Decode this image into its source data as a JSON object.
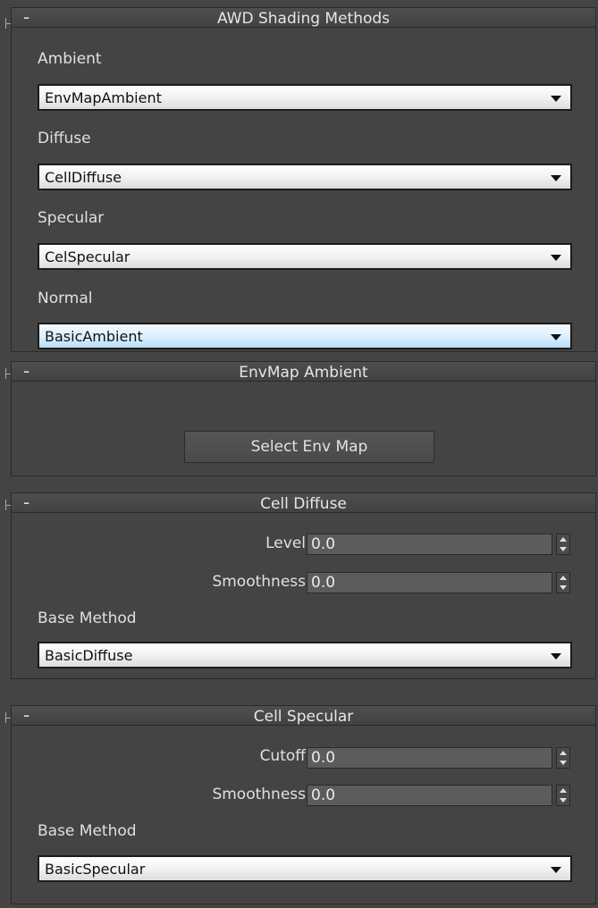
{
  "rollouts": {
    "awd_shading": {
      "collapse_symbol": "-",
      "title": "AWD Shading Methods",
      "ambient_label": "Ambient",
      "ambient_value": "EnvMapAmbient",
      "diffuse_label": "Diffuse",
      "diffuse_value": "CellDiffuse",
      "specular_label": "Specular",
      "specular_value": "CelSpecular",
      "normal_label": "Normal",
      "normal_value": "BasicAmbient"
    },
    "envmap_ambient": {
      "collapse_symbol": "-",
      "title": "EnvMap Ambient",
      "button_label": "Select Env Map"
    },
    "cell_diffuse": {
      "collapse_symbol": "-",
      "title": "Cell Diffuse",
      "level_label": "Level",
      "level_value": "0.0",
      "smoothness_label": "Smoothness",
      "smoothness_value": "0.0",
      "base_method_label": "Base Method",
      "base_method_value": "BasicDiffuse"
    },
    "cell_specular": {
      "collapse_symbol": "-",
      "title": "Cell Specular",
      "cutoff_label": "Cutoff",
      "cutoff_value": "0.0",
      "smoothness_label": "Smoothness",
      "smoothness_value": "0.0",
      "base_method_label": "Base Method",
      "base_method_value": "BasicSpecular"
    }
  },
  "colors": {
    "panel_bg": "#444444",
    "header_bg": "#4a4a4a",
    "dropdown_bg": "#f2f2f2",
    "dropdown_highlight": "#cfe8fb",
    "spinner_bg": "#5c5c5c"
  },
  "icons": {
    "dropdown_arrow": "chevron-down-icon",
    "spinner": "spinner-arrows-icon"
  }
}
